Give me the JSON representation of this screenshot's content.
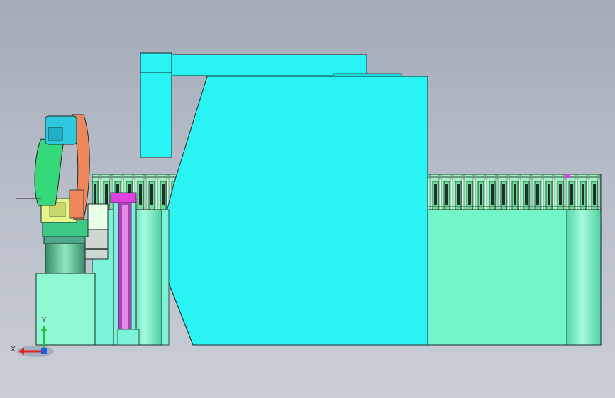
{
  "viewport": {
    "background_top": "#a3aab8",
    "background_bottom": "#c9ced8"
  },
  "colors": {
    "cyan_body": "#2af3f3",
    "cyan_light": "#52f7f7",
    "mint": "#6ff5c8",
    "mint_light": "#8ff9d3",
    "aqua": "#7cf2d8",
    "robot_green": "#36d97a",
    "robot_orange": "#f0875a",
    "robot_yellow": "#e6f58a",
    "robot_cyan": "#2fc8de",
    "magenta": "#e040e0",
    "outline": "#1a2a2a"
  },
  "model": {
    "components": [
      "robot-arm",
      "press-brake",
      "roller-conveyor",
      "base-pedestal",
      "lift-column",
      "side-table"
    ]
  },
  "triad": {
    "x_label": "X",
    "y_label": "Y",
    "x_color": "#e02020",
    "y_color": "#20c040",
    "z_color": "#2060e0"
  }
}
